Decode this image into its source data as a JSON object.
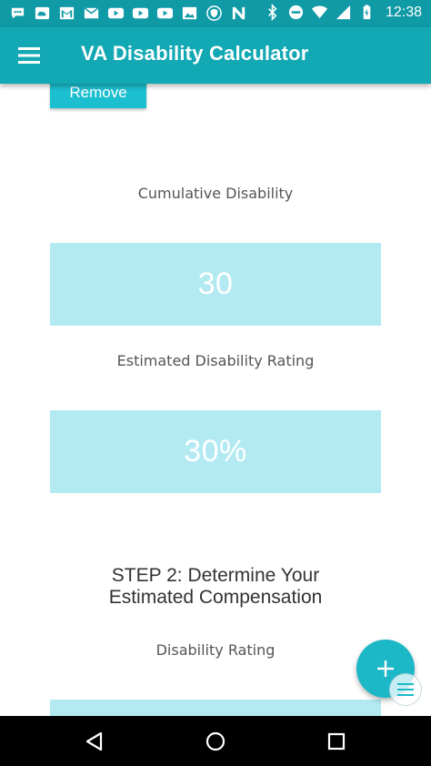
{
  "status_bar": {
    "left_icons": [
      "messenger-icon",
      "cloud-icon",
      "gmail-icon",
      "mail-icon",
      "youtube-icon",
      "youtube-icon",
      "youtube-icon",
      "image-icon",
      "shield-icon",
      "n-app-icon"
    ],
    "right_icons": [
      "bluetooth-icon",
      "do-not-disturb-icon",
      "wifi-icon",
      "signal-icon",
      "battery-icon"
    ],
    "time": "12:38"
  },
  "app_bar": {
    "title": "VA Disability Calculator",
    "menu_icon": "hamburger-menu-icon"
  },
  "content": {
    "remove_label": "Remove",
    "cumulative_label": "Cumulative Disability",
    "cumulative_value": "30",
    "estimated_label": "Estimated Disability Rating",
    "estimated_value": "30%",
    "step2_line1": "STEP 2: Determine Your",
    "step2_line2": "Estimated Compensation",
    "disability_rating_label": "Disability Rating"
  },
  "fab": {
    "icon": "plus-icon"
  },
  "nav_bar": {
    "icons": [
      "back-icon",
      "home-icon",
      "recents-icon"
    ]
  },
  "colors": {
    "status_bar": "#0f9aa6",
    "app_bar": "#12a8b4",
    "accent": "#1cbfcf",
    "value_box": "#b3eaf2"
  }
}
